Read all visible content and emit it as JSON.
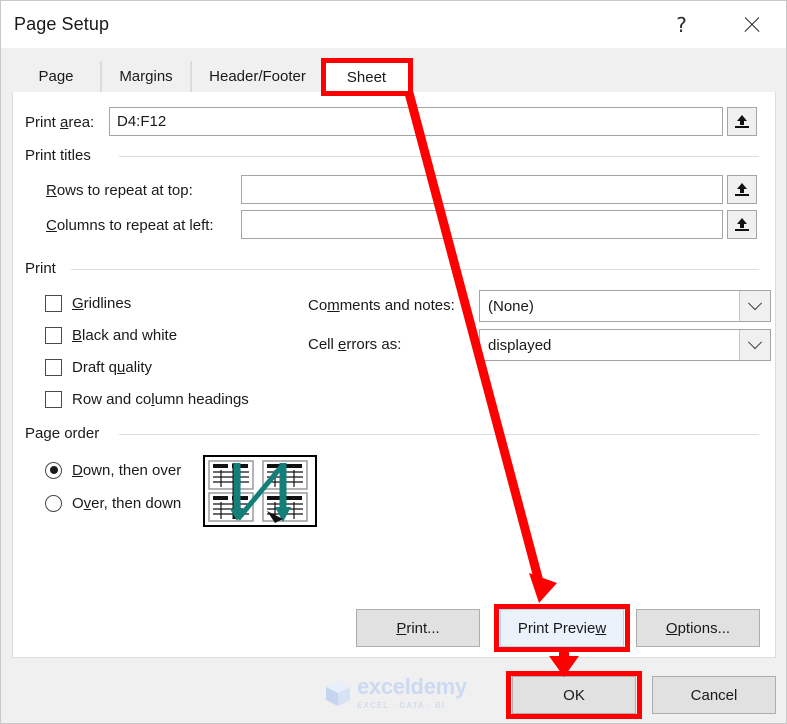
{
  "window": {
    "title": "Page Setup",
    "help_label": "?",
    "close_label": "Close"
  },
  "tabs": [
    {
      "label": "Page",
      "selected": false
    },
    {
      "label": "Margins",
      "selected": false
    },
    {
      "label": "Header/Footer",
      "selected": false
    },
    {
      "label": "Sheet",
      "selected": true
    }
  ],
  "sheet": {
    "print_area": {
      "label": "Print area:",
      "value": "D4:F12",
      "collapse_icon": "collapse-dialog-icon"
    },
    "print_titles": {
      "group_label": "Print titles",
      "rows_label": "Rows to repeat at top:",
      "rows_value": "",
      "cols_label": "Columns to repeat at left:",
      "cols_value": ""
    },
    "print": {
      "group_label": "Print",
      "checkboxes": [
        {
          "label": "Gridlines",
          "checked": false
        },
        {
          "label": "Black and white",
          "checked": false
        },
        {
          "label": "Draft quality",
          "checked": false
        },
        {
          "label": "Row and column headings",
          "checked": false
        }
      ],
      "comments_label": "Comments and notes:",
      "comments_value": "(None)",
      "cell_errors_label": "Cell errors as:",
      "cell_errors_value": "displayed"
    },
    "page_order": {
      "group_label": "Page order",
      "options": [
        {
          "label": "Down, then over",
          "selected": true
        },
        {
          "label": "Over, then down",
          "selected": false
        }
      ],
      "preview_alt": "page-order-preview"
    }
  },
  "footer": {
    "print_label": "Print...",
    "print_preview_label": "Print Preview",
    "options_label": "Options...",
    "ok_label": "OK",
    "cancel_label": "Cancel"
  },
  "watermark": {
    "name": "exceldemy",
    "tagline": "EXCEL · DATA · BI"
  },
  "annotations": {
    "highlight_color": "#ff0000",
    "highlights": [
      {
        "target": "tab-sheet"
      },
      {
        "target": "print-preview-button"
      },
      {
        "target": "ok-button"
      }
    ],
    "arrows": [
      {
        "from": "tab-sheet",
        "to": "print-preview-button"
      },
      {
        "from": "print-preview-button",
        "to": "ok-button"
      }
    ]
  }
}
